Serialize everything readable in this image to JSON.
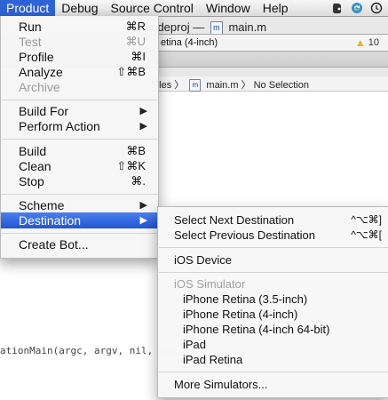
{
  "menubar": {
    "items": [
      "Product",
      "Debug",
      "Source Control",
      "Window",
      "Help"
    ],
    "active_index": 0
  },
  "window": {
    "title_partial": "r.xcodeproj",
    "title_sep": "—",
    "file_name": "main.m",
    "doc_icon_letter": "m",
    "scheme_text": "etina (4-inch)",
    "warning_count": "10",
    "jumpbar_path": "Files",
    "jumpbar_file": "main.m",
    "jumpbar_tail": "No Selection",
    "code_partial": "ationMain(argc, argv, nil, NSS"
  },
  "product_menu": {
    "run": {
      "label": "Run",
      "shortcut": "⌘R"
    },
    "test": {
      "label": "Test",
      "shortcut": "⌘U"
    },
    "profile": {
      "label": "Profile",
      "shortcut": "⌘I"
    },
    "analyze": {
      "label": "Analyze",
      "shortcut": "⇧⌘B"
    },
    "archive": {
      "label": "Archive"
    },
    "build_for": {
      "label": "Build For"
    },
    "perform_action": {
      "label": "Perform Action"
    },
    "build": {
      "label": "Build",
      "shortcut": "⌘B"
    },
    "clean": {
      "label": "Clean",
      "shortcut": "⇧⌘K"
    },
    "stop": {
      "label": "Stop",
      "shortcut": "⌘."
    },
    "scheme": {
      "label": "Scheme"
    },
    "destination": {
      "label": "Destination"
    },
    "create_bot": {
      "label": "Create Bot..."
    },
    "submenu_arrow": "▶"
  },
  "destination_menu": {
    "select_next": {
      "label": "Select Next Destination",
      "shortcut": "^⌥⌘]"
    },
    "select_prev": {
      "label": "Select Previous Destination",
      "shortcut": "^⌥⌘["
    },
    "ios_device": "iOS Device",
    "ios_simulator_header": "iOS Simulator",
    "simulators": [
      "iPhone Retina (3.5-inch)",
      "iPhone Retina (4-inch)",
      "iPhone Retina (4-inch 64-bit)",
      "iPad",
      "iPad Retina"
    ],
    "more_simulators": "More Simulators..."
  },
  "colors": {
    "highlight": "#2d63d4",
    "warning": "#f0b31b"
  },
  "icons": [
    "evernote-icon",
    "sync-icon",
    "time-machine-icon",
    "warning-icon",
    "document-icon"
  ]
}
